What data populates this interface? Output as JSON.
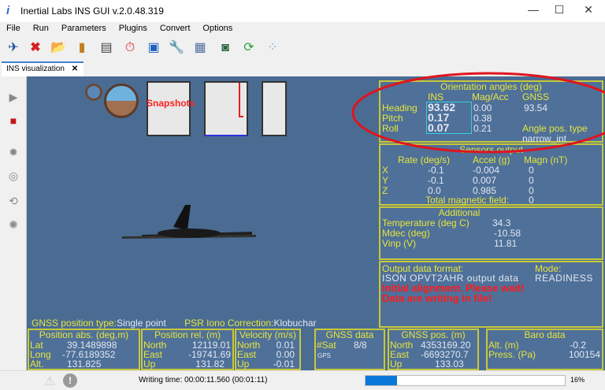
{
  "window": {
    "title": "Inertial Labs INS GUI v.2.0.48.319",
    "minimize": "—",
    "maximize": "☐",
    "close": "✕"
  },
  "menu": [
    "File",
    "Run",
    "Parameters",
    "Plugins",
    "Convert",
    "Options"
  ],
  "toolbar_icons": [
    "connect-icon",
    "stop-icon",
    "open-folder-icon",
    "save-icon",
    "book-icon",
    "timer-icon",
    "image-icon",
    "wrench-icon",
    "calculator-icon",
    "storage-icon",
    "sync-icon",
    "dots-icon"
  ],
  "tab": {
    "label": "INS visualization",
    "close": "✕"
  },
  "snapshots_label": "Snapshots",
  "orientation": {
    "title": "Orientation angles (deg)",
    "cols": [
      "INS",
      "Mag/Acc",
      "GNSS"
    ],
    "rows": [
      {
        "label": "Heading",
        "ins": "93.62",
        "mag": "0.00",
        "gnss": "93.54"
      },
      {
        "label": "Pitch",
        "ins": "0.17",
        "mag": "0.38"
      },
      {
        "label": "Roll",
        "ins": "0.07",
        "mag": "0.21"
      }
    ],
    "angle_type_label": "Angle pos. type",
    "angle_type": "narrow_int"
  },
  "sensors": {
    "title": "Sensors output",
    "cols": [
      "Rate (deg/s)",
      "Accel (g)",
      "Magn (nT)"
    ],
    "rows": [
      {
        "axis": "X",
        "rate": "-0.1",
        "accel": "-0.004",
        "magn": "0"
      },
      {
        "axis": "Y",
        "rate": "-0.1",
        "accel": "0.007",
        "magn": "0"
      },
      {
        "axis": "Z",
        "rate": "0.0",
        "accel": "0.985",
        "magn": "0"
      }
    ],
    "total_label": "Total magnetic field:",
    "total": "0"
  },
  "additional": {
    "title": "Additional",
    "rows": [
      {
        "label": "Temperature (deg C)",
        "value": "34.3"
      },
      {
        "label": "Mdec (deg)",
        "value": "-10.58"
      },
      {
        "label": "Vinp (V)",
        "value": "11.81"
      }
    ]
  },
  "output": {
    "format_label": "Output data format:",
    "format": "ISON OPVT2AHR output data",
    "mode_label": "Mode:",
    "mode": "READINESS",
    "msg1": "Initial alignment. Please wait!",
    "msg2": "Data are writing in file!"
  },
  "gnss_line": {
    "pos_type_label": "GNSS position type:",
    "pos_type": "Single point",
    "psr_label": "PSR Iono Correction:",
    "psr": "Klobuchar"
  },
  "pos_abs": {
    "title": "Position abs. (deg,m)",
    "rows": [
      {
        "label": "Lat",
        "value": "39.1489898"
      },
      {
        "label": "Long",
        "value": "-77.6189352"
      },
      {
        "label": "Alt.",
        "value": "131.825"
      }
    ]
  },
  "pos_rel": {
    "title": "Position rel. (m)",
    "rows": [
      {
        "label": "North",
        "value": "12119.01"
      },
      {
        "label": "East",
        "value": "-19741.69"
      },
      {
        "label": "Up",
        "value": "131.82"
      }
    ]
  },
  "velocity": {
    "title": "Velocity (m/s)",
    "rows": [
      {
        "label": "North",
        "value": "0.01"
      },
      {
        "label": "East",
        "value": "0.00"
      },
      {
        "label": "Up",
        "value": "-0.01"
      }
    ]
  },
  "gnss_data": {
    "title": "GNSS data",
    "sat_label": "#Sat",
    "sat": "8/8",
    "system": "GPS"
  },
  "gnss_pos": {
    "title": "GNSS pos. (m)",
    "rows": [
      {
        "label": "North",
        "value": "4353169.20"
      },
      {
        "label": "East",
        "value": "-6693270.7"
      },
      {
        "label": "Up",
        "value": "133.03"
      }
    ]
  },
  "baro": {
    "title": "Baro data",
    "rows": [
      {
        "label": "Alt. (m)",
        "value": "-0.2"
      },
      {
        "label": "Press. (Pa)",
        "value": "100154"
      }
    ]
  },
  "status": {
    "writing_time": "Writing time: 00:00:11.560 (00:01:11)",
    "progress_percent": 16,
    "progress_label": "16%"
  },
  "colors": {
    "panel": "#4f7099",
    "label": "#e6e63c",
    "alert": "#ff1a1a",
    "highlight_ellipse": "#e0141e"
  }
}
